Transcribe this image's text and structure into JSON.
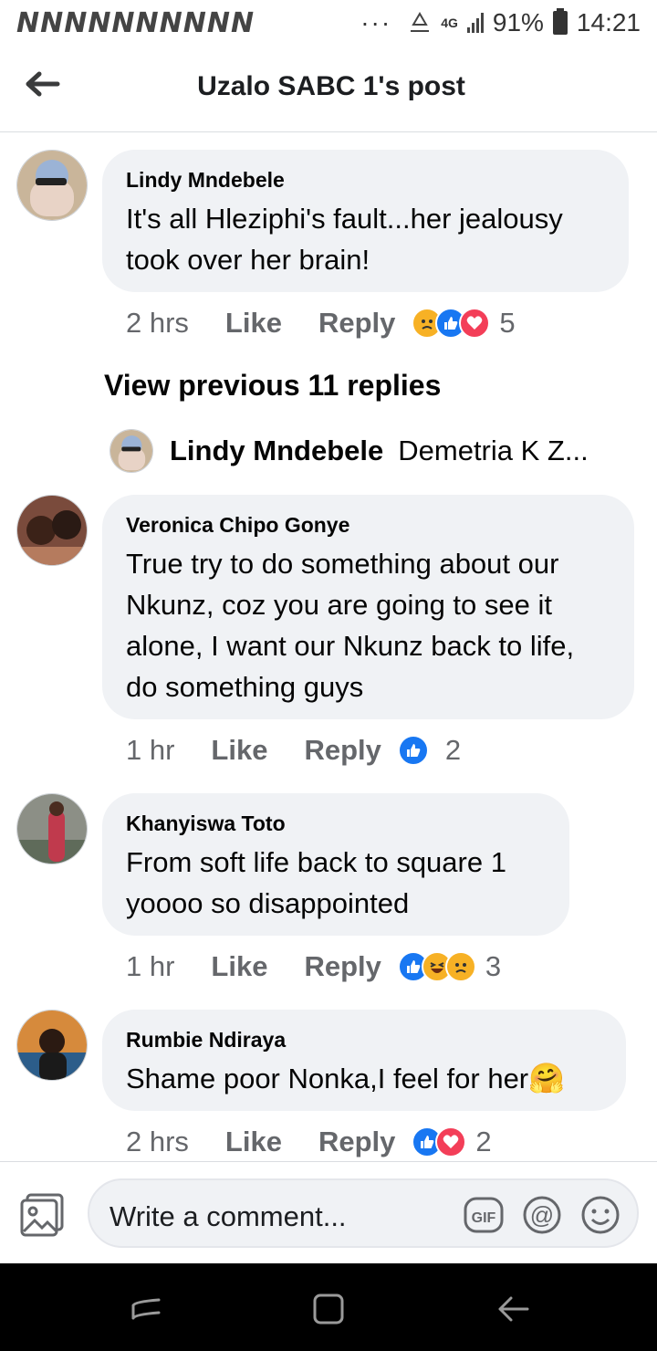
{
  "status_bar": {
    "notification_glyphs": "NNNNNNNNNN",
    "more": "···",
    "network": "4G",
    "battery": "91%",
    "time": "14:21"
  },
  "header": {
    "title": "Uzalo SABC 1's post"
  },
  "comments": [
    {
      "author": "Lindy Mndebele",
      "text": "It's all Hleziphi's fault...her jealousy took over her brain!",
      "time": "2 hrs",
      "like": "Like",
      "reply": "Reply",
      "reactions": [
        "sad",
        "like",
        "love"
      ],
      "reaction_count": "5"
    },
    {
      "author": "Veronica Chipo Gonye",
      "text": "True try to do something  about our Nkunz, coz you are going to see it alone, I want our Nkunz back to life, do something guys",
      "time": "1 hr",
      "like": "Like",
      "reply": "Reply",
      "reactions": [
        "like"
      ],
      "reaction_count": "2"
    },
    {
      "author": "Khanyiswa Toto",
      "text": "From soft life back to square 1 yoooo so disappointed",
      "time": "1 hr",
      "like": "Like",
      "reply": "Reply",
      "reactions": [
        "like",
        "haha",
        "sad"
      ],
      "reaction_count": "3"
    },
    {
      "author": "Rumbie Ndiraya",
      "text": "Shame poor Nonka,I feel for her",
      "emoji": "🤗",
      "time": "2 hrs",
      "like": "Like",
      "reply": "Reply",
      "reactions": [
        "like",
        "love"
      ],
      "reaction_count": "2"
    }
  ],
  "thread": {
    "view_previous": "View previous 11 replies",
    "reply_preview_author": "Lindy Mndebele",
    "reply_preview_text": "Demetria K Z..."
  },
  "composer": {
    "placeholder": "Write a comment...",
    "gif_label": "GIF",
    "at_label": "@"
  },
  "colors": {
    "accent": "#1877f2",
    "love": "#f33e58",
    "bubble": "#f0f2f5",
    "meta_text": "#65676b"
  }
}
